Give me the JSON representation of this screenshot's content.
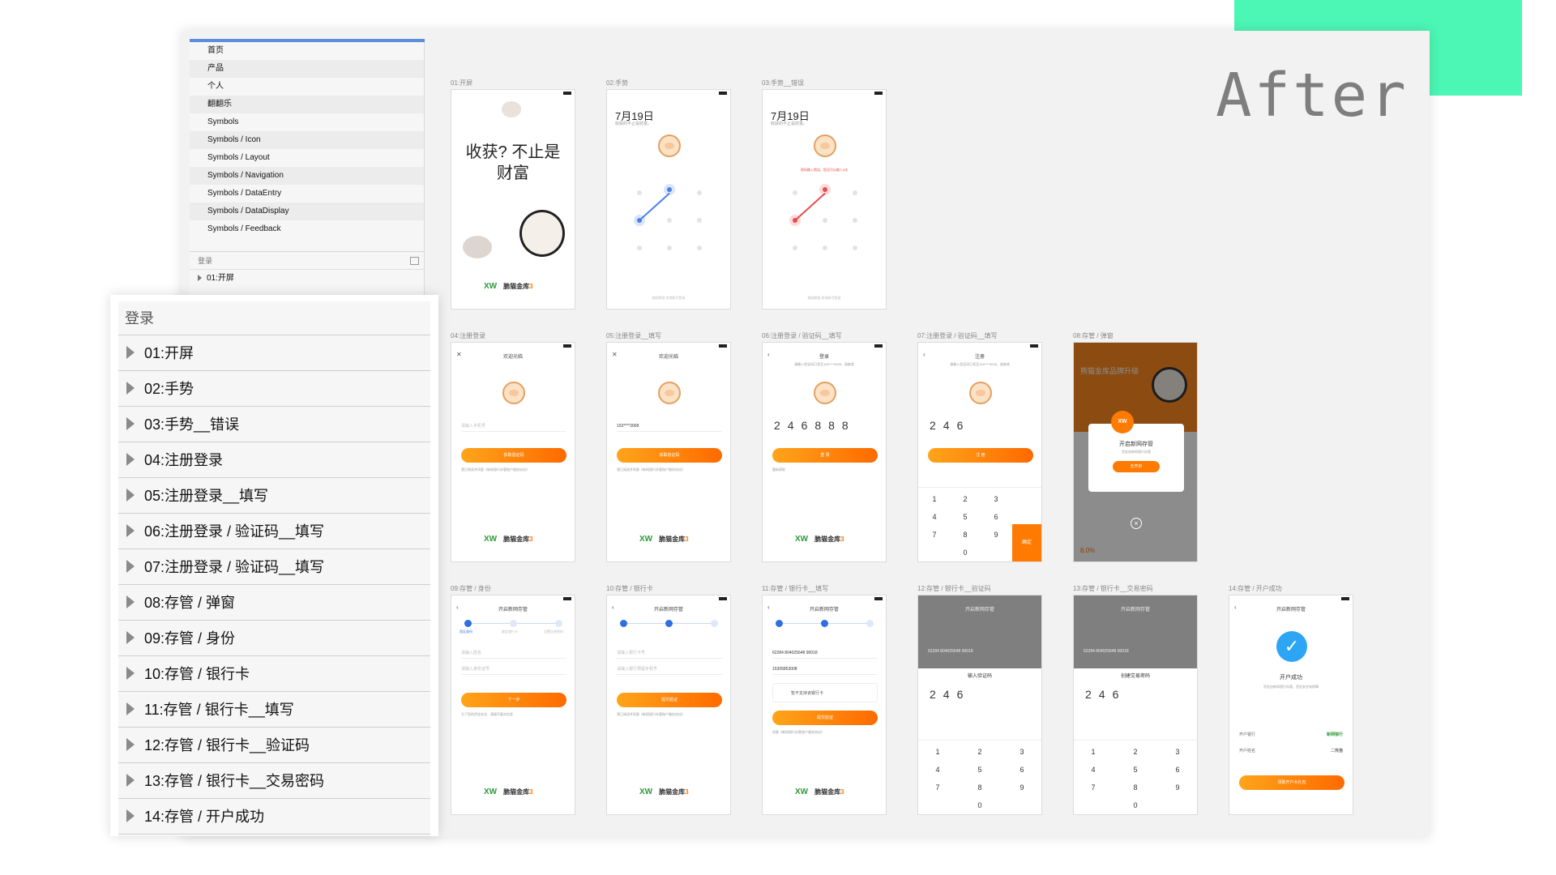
{
  "corner_text": "After",
  "layers_panel": {
    "pages": [
      "首页",
      "产品",
      "个人",
      "翻翻乐",
      "Symbols",
      "Symbols / Icon",
      "Symbols / Layout",
      "Symbols / Navigation",
      "Symbols / DataEntry",
      "Symbols / DataDisplay",
      "Symbols / Feedback"
    ],
    "section_title": "登录",
    "first_artboard": "01:开屏"
  },
  "zoom_panel": {
    "title": "登录",
    "items": [
      "01:开屏",
      "02:手势",
      "03:手势__错误",
      "04:注册登录",
      "05:注册登录__填写",
      "06:注册登录 / 验证码__填写",
      "07:注册登录 / 验证码__填写",
      "08:存管 / 弹窗",
      "09:存管 / 身份",
      "10:存管 / 银行卡",
      "11:存管 / 银行卡__填写",
      "12:存管 / 银行卡__验证码",
      "13:存管 / 银行卡__交易密码",
      "14:存管 / 开户成功"
    ]
  },
  "artboards": {
    "a01": {
      "label": "01:开屏",
      "slogan": "收获? 不止是财富",
      "brand_logo": "XW",
      "brand_name": "脆猫金库",
      "brand_num": "3"
    },
    "a02": {
      "label": "02:手势",
      "date": "7月19日",
      "subtitle": "收获的不止是财富。",
      "footer": "指纹解锁    其他账号登录"
    },
    "a03": {
      "label": "03:手势__错误",
      "date": "7月19日",
      "subtitle": "收获的不止是财富。",
      "error": "密码输入错误，您还可以输入4次",
      "footer": "指纹解锁    其他账号登录"
    },
    "a04": {
      "label": "04:注册登录",
      "title": "欢迎光临",
      "placeholder": "请输入手机号",
      "button": "获取验证码",
      "agree": "我已阅读并同意《新网银行存管账户服务协议》",
      "brand_logo": "XW",
      "brand_name": "脆猫金库",
      "brand_num": "3"
    },
    "a05": {
      "label": "05:注册登录__填写",
      "title": "欢迎光临",
      "phone": "153****3008",
      "button": "获取验证码",
      "agree": "我已阅读并同意《新网银行存管账户服务协议》",
      "brand_logo": "XW",
      "brand_name": "脆猫金库",
      "brand_num": "3"
    },
    "a06": {
      "label": "06:注册登录 / 验证码__填写",
      "title": "登录",
      "hint": "请输入验证码已发至153****3008，请查收",
      "code": "246888",
      "button": "登 录",
      "resend": "重新获取",
      "brand_logo": "XW",
      "brand_name": "脆猫金库",
      "brand_num": "3"
    },
    "a07": {
      "label": "07:注册登录 / 验证码__填写",
      "title": "注册",
      "hint": "请输入验证码已发至153****3008，请查收",
      "code": "246",
      "button": "注 册",
      "keys": [
        "1",
        "2",
        "3",
        "4",
        "5",
        "6",
        "7",
        "8",
        "9",
        "0"
      ],
      "confirm": "确定"
    },
    "a08": {
      "label": "08:存管 / 弹窗",
      "header": "熊猫金库品牌升级",
      "badge": "XW",
      "modal_title": "开启新网存管",
      "modal_sub": "资金由新网银行存管",
      "modal_button": "去开启",
      "close": "×",
      "bottom_value": "8.0%"
    },
    "a09": {
      "label": "09:存管 / 身份",
      "title": "开启新网存管",
      "step1": "验证身份",
      "step2": "绑定银行卡",
      "step3": "设置交易密码",
      "f1": "请输入姓名",
      "f2": "请输入身份证号",
      "button": "下一步",
      "agree": "为了您的资金安全，请填写真实信息",
      "brand_logo": "XW",
      "brand_name": "脆猫金库",
      "brand_num": "3"
    },
    "a10": {
      "label": "10:存管 / 银行卡",
      "title": "开启新网存管",
      "f1": "请输入银行卡号",
      "f2": "请输入银行预留手机号",
      "button": "提交验证",
      "agree": "我已阅读并同意《新网银行存管账户服务协议》",
      "brand_logo": "XW",
      "brand_name": "脆猫金库",
      "brand_num": "3"
    },
    "a11": {
      "label": "11:存管 / 银行卡__填写",
      "title": "开启新网存管",
      "card": "62284 804025648 90018",
      "phone": "15305853008",
      "unsupported": "暂不支持该银行卡",
      "button": "提交验证",
      "agree": "同意《新网银行存管账户服务协议》",
      "brand_logo": "XW",
      "brand_name": "脆猫金库",
      "brand_num": "3"
    },
    "a12": {
      "label": "12:存管 / 银行卡__验证码",
      "title": "开启新网存管",
      "card": "62284 804025648 90018",
      "sheet_title": "输入验证码",
      "code": "246",
      "keys": [
        "1",
        "2",
        "3",
        "4",
        "5",
        "6",
        "7",
        "8",
        "9",
        "0"
      ]
    },
    "a13": {
      "label": "13:存管 / 银行卡__交易密码",
      "title": "开启新网存管",
      "card": "62284 804025648 90018",
      "sheet_title": "创建交易密码",
      "code": "246",
      "keys": [
        "1",
        "2",
        "3",
        "4",
        "5",
        "6",
        "7",
        "8",
        "9",
        "0"
      ]
    },
    "a14": {
      "label": "14:存管 / 开户成功",
      "title": "开启新网存管",
      "success": "开户成功",
      "desc": "资金由新网银行存管，资金安全有保障",
      "row1_label": "开户银行",
      "row1_value": "新网银行",
      "row2_label": "开户姓名",
      "row2_value": "二熊猫",
      "button": "领取开户大礼包"
    }
  }
}
